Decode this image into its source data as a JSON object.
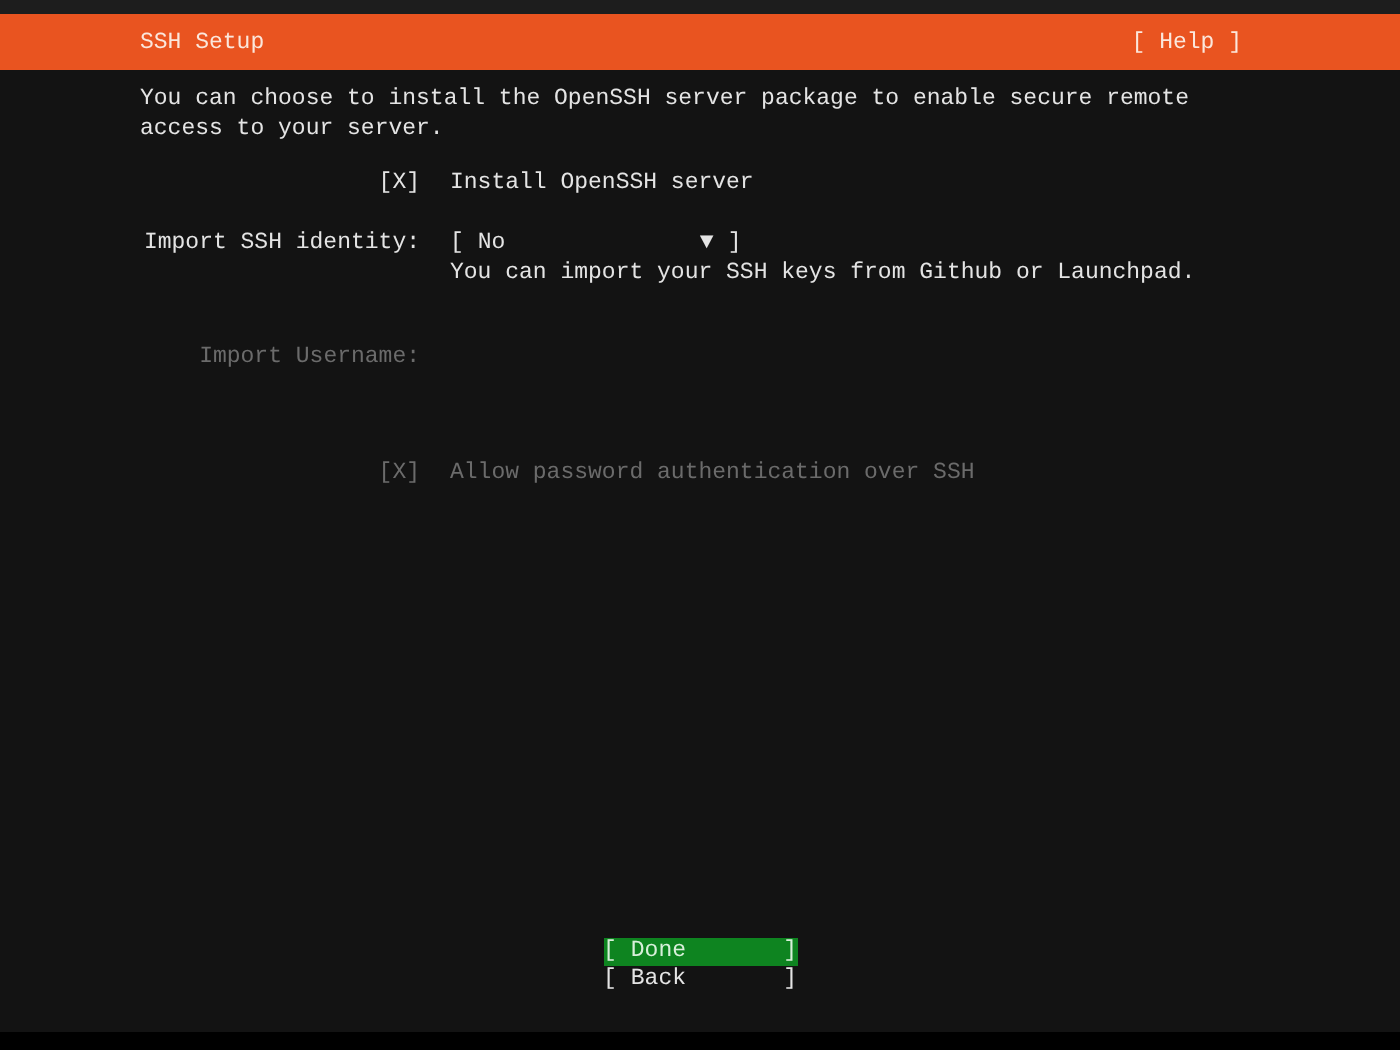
{
  "header": {
    "title": "SSH Setup",
    "help": "[ Help ]"
  },
  "description": "You can choose to install the OpenSSH server package to enable secure remote access to your server.",
  "fields": [
    {
      "kind": "checkbox",
      "open": "[",
      "mark": "X",
      "close": "]",
      "checked": true,
      "disabled": false,
      "label": "Install OpenSSH server"
    },
    {
      "kind": "dropdown",
      "label": "Import SSH identity:",
      "open": "[",
      "value": "No",
      "arrow": "▼",
      "close": "]",
      "hint": "You can import your SSH keys from Github or Launchpad.",
      "disabled": false
    },
    {
      "kind": "text",
      "label": "Import Username:",
      "disabled": true
    },
    {
      "kind": "checkbox",
      "open": "[",
      "mark": "X",
      "close": "]",
      "checked": true,
      "disabled": true,
      "label": "Allow password authentication over SSH"
    }
  ],
  "buttons": [
    {
      "open": "[",
      "label": "Done",
      "close": "]",
      "selected": true
    },
    {
      "open": "[",
      "label": "Back",
      "close": "]",
      "selected": false
    }
  ]
}
